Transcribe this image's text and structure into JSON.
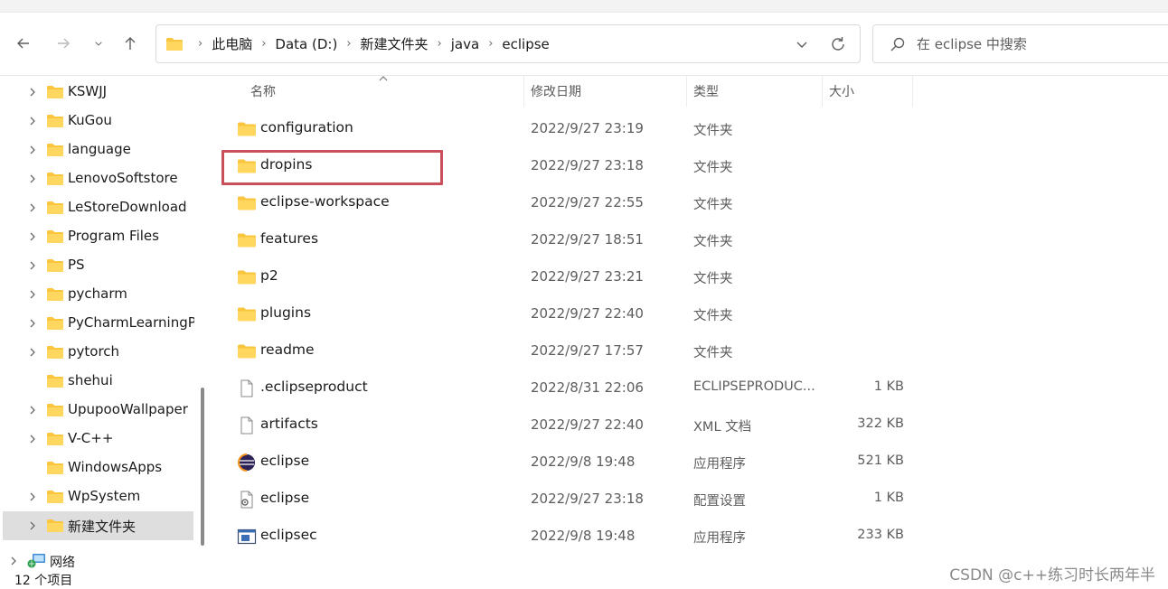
{
  "window": {
    "colors": {
      "accent_folder": "#ffcf48",
      "highlight": "#c9505a",
      "selected_bg": "#dedede"
    }
  },
  "nav": {
    "back_icon": "arrow-left-icon",
    "forward_icon": "arrow-right-icon",
    "recent_icon": "chevron-down-icon",
    "up_icon": "arrow-up-icon"
  },
  "address": {
    "crumbs": [
      "此电脑",
      "Data (D:)",
      "新建文件夹",
      "java",
      "eclipse"
    ],
    "dropdown_icon": "chevron-down-icon",
    "refresh_icon": "refresh-icon"
  },
  "search": {
    "placeholder": "在 eclipse 中搜索",
    "value": ""
  },
  "sidebar": {
    "items": [
      {
        "label": "KSWJJ",
        "expandable": true
      },
      {
        "label": "KuGou",
        "expandable": true
      },
      {
        "label": "language",
        "expandable": true
      },
      {
        "label": "LenovoSoftstore",
        "expandable": true
      },
      {
        "label": "LeStoreDownload",
        "expandable": true
      },
      {
        "label": "Program Files",
        "expandable": true
      },
      {
        "label": "PS",
        "expandable": true
      },
      {
        "label": "pycharm",
        "expandable": true
      },
      {
        "label": "PyCharmLearningProject",
        "expandable": true
      },
      {
        "label": "pytorch",
        "expandable": true
      },
      {
        "label": "shehui",
        "expandable": false
      },
      {
        "label": "UpupooWallpaper",
        "expandable": true
      },
      {
        "label": "V-C++",
        "expandable": true
      },
      {
        "label": "WindowsApps",
        "expandable": false
      },
      {
        "label": "WpSystem",
        "expandable": true
      },
      {
        "label": "新建文件夹",
        "expandable": true,
        "selected": true
      }
    ],
    "network": {
      "label": "网络"
    }
  },
  "columns": {
    "name": "名称",
    "modified": "修改日期",
    "type": "类型",
    "size": "大小"
  },
  "files": [
    {
      "name": "configuration",
      "modified": "2022/9/27 23:19",
      "type": "文件夹",
      "size": "",
      "icon": "folder-icon"
    },
    {
      "name": "dropins",
      "modified": "2022/9/27 23:18",
      "type": "文件夹",
      "size": "",
      "icon": "folder-icon",
      "highlighted": true
    },
    {
      "name": "eclipse-workspace",
      "modified": "2022/9/27 22:55",
      "type": "文件夹",
      "size": "",
      "icon": "folder-icon"
    },
    {
      "name": "features",
      "modified": "2022/9/27 18:51",
      "type": "文件夹",
      "size": "",
      "icon": "folder-icon"
    },
    {
      "name": "p2",
      "modified": "2022/9/27 23:21",
      "type": "文件夹",
      "size": "",
      "icon": "folder-icon"
    },
    {
      "name": "plugins",
      "modified": "2022/9/27 22:40",
      "type": "文件夹",
      "size": "",
      "icon": "folder-icon"
    },
    {
      "name": "readme",
      "modified": "2022/9/27 17:57",
      "type": "文件夹",
      "size": "",
      "icon": "folder-icon"
    },
    {
      "name": ".eclipseproduct",
      "modified": "2022/8/31 22:06",
      "type": "ECLIPSEPRODUC...",
      "size": "1 KB",
      "icon": "file-icon"
    },
    {
      "name": "artifacts",
      "modified": "2022/9/27 22:40",
      "type": "XML 文档",
      "size": "322 KB",
      "icon": "file-icon"
    },
    {
      "name": "eclipse",
      "modified": "2022/9/8 19:48",
      "type": "应用程序",
      "size": "521 KB",
      "icon": "eclipse-app-icon"
    },
    {
      "name": "eclipse",
      "modified": "2022/9/27 23:18",
      "type": "配置设置",
      "size": "1 KB",
      "icon": "config-file-icon"
    },
    {
      "name": "eclipsec",
      "modified": "2022/9/8 19:48",
      "type": "应用程序",
      "size": "233 KB",
      "icon": "console-app-icon"
    }
  ],
  "status": {
    "count": "12 个项目"
  },
  "watermark": "CSDN @c++练习时长两年半"
}
